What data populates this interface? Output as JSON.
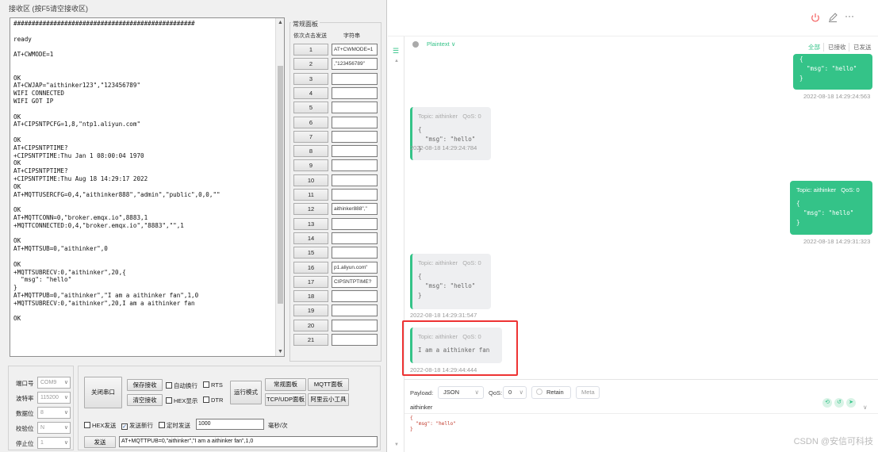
{
  "serial_tool": {
    "recv_title": "接收区 (按F5请空接收区)",
    "recv_lines": [
      "##################################################",
      "",
      "ready",
      "",
      "AT+CWMODE=1",
      "",
      "",
      "OK",
      "AT+CWJAP=\"aithinker123\",\"123456789\"",
      "WIFI CONNECTED",
      "WIFI GOT IP",
      "",
      "OK",
      "AT+CIPSNTPCFG=1,8,\"ntp1.aliyun.com\"",
      "",
      "OK",
      "AT+CIPSNTPTIME?",
      "+CIPSNTPTIME:Thu Jan 1 08:00:04 1970",
      "OK",
      "AT+CIPSNTPTIME?",
      "+CIPSNTPTIME:Thu Aug 18 14:29:17 2022",
      "OK",
      "AT+MQTTUSERCFG=0,4,\"aithinker888\",\"admin\",\"public\",0,0,\"\"",
      "",
      "OK",
      "AT+MQTTCONN=0,\"broker.emqx.io\",8883,1",
      "+MQTTCONNECTED:0,4,\"broker.emqx.io\",\"8883\",\"\",1",
      "",
      "OK",
      "AT+MQTTSUB=0,\"aithinker\",0",
      "",
      "OK",
      "+MQTTSUBRECV:0,\"aithinker\",20,{",
      "  \"msg\": \"hello\"",
      "}",
      "AT+MQTTPUB=0,\"aithinker\",\"I am a aithinker fan\",1,0",
      "+MQTTSUBRECV:0,\"aithinker\",20,I am a aithinker fan",
      "",
      "OK"
    ],
    "multi": {
      "title": "常规面板",
      "col1": "依次点击发送",
      "col2": "字符串",
      "rows": [
        {
          "n": "1",
          "v": "AT+CWMODE=1"
        },
        {
          "n": "2",
          "v": ",\"123456789\""
        },
        {
          "n": "3",
          "v": ""
        },
        {
          "n": "4",
          "v": ""
        },
        {
          "n": "5",
          "v": ""
        },
        {
          "n": "6",
          "v": ""
        },
        {
          "n": "7",
          "v": ""
        },
        {
          "n": "8",
          "v": ""
        },
        {
          "n": "9",
          "v": ""
        },
        {
          "n": "10",
          "v": ""
        },
        {
          "n": "11",
          "v": ""
        },
        {
          "n": "12",
          "v": "aithinker888\",\""
        },
        {
          "n": "13",
          "v": ""
        },
        {
          "n": "14",
          "v": ""
        },
        {
          "n": "15",
          "v": ""
        },
        {
          "n": "16",
          "v": "p1.aliyun.com\""
        },
        {
          "n": "17",
          "v": "CIPSNTPTIME?"
        },
        {
          "n": "18",
          "v": ""
        },
        {
          "n": "19",
          "v": ""
        },
        {
          "n": "20",
          "v": ""
        },
        {
          "n": "21",
          "v": ""
        }
      ]
    },
    "bottom": {
      "port_label": "端口号",
      "port_value": "COM9",
      "baud_label": "波特率",
      "baud_value": "115200",
      "data_label": "数据位",
      "data_value": "8",
      "parity_label": "校验位",
      "parity_value": "N",
      "stop_label": "停止位",
      "stop_value": "1",
      "close_port": "关闭串口",
      "save_recv": "保存接收",
      "clear_recv": "清空接收",
      "auto_wrap": "自动换行",
      "rts": "RTS",
      "hex_show": "HEX显示",
      "dtr": "DTR",
      "run_mode": "运行模式",
      "normal_panel": "常规面板",
      "mqtt_panel": "MQTT面板",
      "tcp_panel": "TCP/UDP面板",
      "cloud_tool": "阿里云小工具",
      "hex_send": "HEX发送",
      "send_newline": "发送新行",
      "timed_send": "定时发送",
      "interval_value": "1000",
      "interval_unit": "毫秒/次",
      "send_btn": "发送",
      "send_value": "AT+MQTTPUB=0,\"aithinker\",\"I am a aithinker fan\",1,0"
    }
  },
  "mqtt_client": {
    "format_label": "Plaintext",
    "filters": [
      "全部",
      "已接收",
      "已发送"
    ],
    "messages": [
      {
        "dir": "out",
        "code": "{\n  \"msg\": \"hello\"\n}",
        "time": "2022-08-18 14:29:24:563"
      },
      {
        "dir": "in",
        "topic": "Topic: aithinker",
        "qos": "QoS: 0",
        "code": "{\n  \"msg\": \"hello\"\n}",
        "time": "2022-08-18 14:29:24:784"
      },
      {
        "dir": "out",
        "topic": "Topic: aithinker",
        "qos": "QoS: 0",
        "code": "{\n  \"msg\": \"hello\"\n}",
        "time": "2022-08-18 14:29:31:323"
      },
      {
        "dir": "in",
        "topic": "Topic: aithinker",
        "qos": "QoS: 0",
        "code": "{\n  \"msg\": \"hello\"\n}",
        "time": "2022-08-18 14:29:31:547"
      },
      {
        "dir": "in",
        "topic": "Topic: aithinker",
        "qos": "QoS: 0",
        "code": "I am a aithinker fan",
        "time": "2022-08-18 14:29:44:444"
      }
    ],
    "composer": {
      "payload_label": "Payload:",
      "payload_format": "JSON",
      "qos_label": "QoS:",
      "qos_value": "0",
      "retain": "Retain",
      "meta": "Meta",
      "topic": "aithinker",
      "body": "{\n  \"msg\": \"hello\"\n}"
    },
    "watermark": "CSDN @安信可科技"
  },
  "colors": {
    "accent": "#34c388",
    "highlight": "#e33333",
    "power": "#f56c6c"
  }
}
